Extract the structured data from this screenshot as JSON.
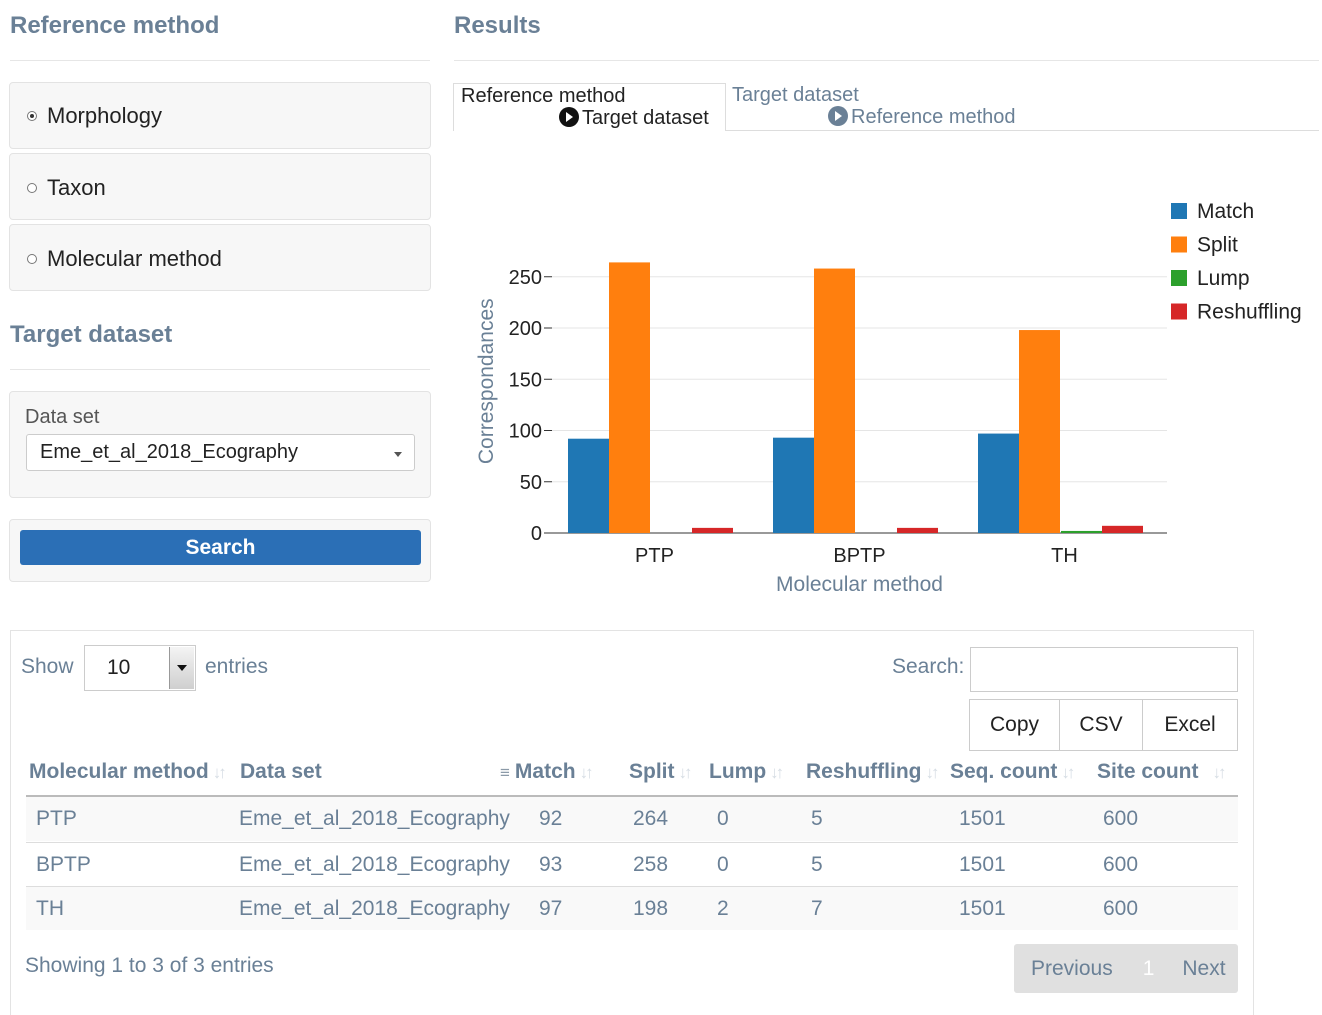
{
  "sidebar": {
    "reference_title": "Reference method",
    "options": [
      {
        "label": "Morphology",
        "selected": true
      },
      {
        "label": "Taxon",
        "selected": false
      },
      {
        "label": "Molecular method",
        "selected": false
      }
    ],
    "target_title": "Target dataset",
    "dataset_label": "Data set",
    "dataset_value": "Eme_et_al_2018_Ecography",
    "search_button": "Search"
  },
  "results": {
    "title": "Results",
    "tabs": [
      {
        "line1": "Reference method",
        "line2": "Target dataset",
        "active": true
      },
      {
        "line1": "Target dataset",
        "line2": "Reference method",
        "active": false
      }
    ]
  },
  "chart_data": {
    "type": "bar",
    "categories": [
      "PTP",
      "BPTP",
      "TH"
    ],
    "series": [
      {
        "name": "Match",
        "values": [
          92,
          93,
          97
        ],
        "color": "#1f77b4"
      },
      {
        "name": "Split",
        "values": [
          264,
          258,
          198
        ],
        "color": "#ff7f0e"
      },
      {
        "name": "Lump",
        "values": [
          0,
          0,
          2
        ],
        "color": "#2ca02c"
      },
      {
        "name": "Reshuffling",
        "values": [
          5,
          5,
          7
        ],
        "color": "#d62728"
      }
    ],
    "xlabel": "Molecular method",
    "ylabel": "Correspondances",
    "yticks": [
      0,
      50,
      100,
      150,
      200,
      250
    ],
    "ylim": [
      0,
      300
    ],
    "grid": true,
    "legend": "right"
  },
  "table": {
    "show_label": "Show",
    "show_value": "10",
    "entries_label": "entries",
    "search_label": "Search:",
    "search_value": "",
    "buttons": [
      "Copy",
      "CSV",
      "Excel"
    ],
    "columns": [
      "Molecular method",
      "Data set",
      "Match",
      "Split",
      "Lump",
      "Reshuffling",
      "Seq. count",
      "Site count"
    ],
    "rows": [
      [
        "PTP",
        "Eme_et_al_2018_Ecography",
        "92",
        "264",
        "0",
        "5",
        "1501",
        "600"
      ],
      [
        "BPTP",
        "Eme_et_al_2018_Ecography",
        "93",
        "258",
        "0",
        "5",
        "1501",
        "600"
      ],
      [
        "TH",
        "Eme_et_al_2018_Ecography",
        "97",
        "198",
        "2",
        "7",
        "1501",
        "600"
      ]
    ],
    "info": "Showing 1 to 3 of 3 entries",
    "pagination": {
      "previous": "Previous",
      "page": "1",
      "next": "Next"
    }
  }
}
